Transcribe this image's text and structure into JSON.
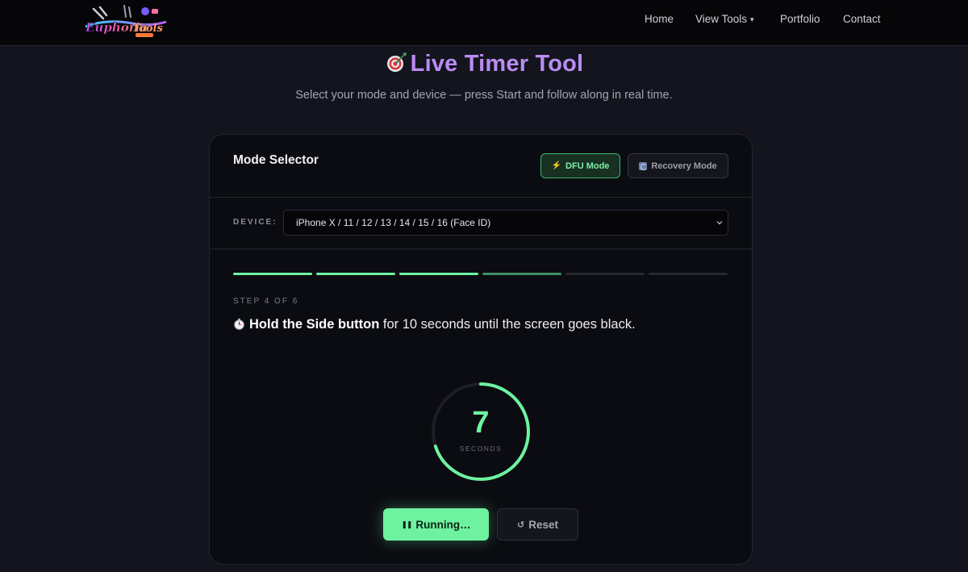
{
  "nav": {
    "home": "Home",
    "view_tools": "View Tools",
    "view_tools_caret": "▾",
    "portfolio": "Portfolio",
    "contact": "Contact"
  },
  "header": {
    "title": "Live Timer Tool",
    "subtitle": "Select your mode and device — press Start and follow along in real time."
  },
  "card": {
    "title": "Mode Selector",
    "modes": [
      {
        "label": "DFU Mode",
        "icon": "⚡",
        "selected": true
      },
      {
        "label": "Recovery Mode",
        "icon": "recovery-icon",
        "selected": false
      }
    ],
    "device_label": "DEVICE:",
    "device_value": "iPhone X / 11 / 12 / 13 / 14 / 15 / 16 (Face ID)",
    "progress": {
      "total_steps": 6,
      "completed_steps": 3,
      "current_step": 4
    },
    "step_label": "STEP 4 OF 6",
    "instruction": {
      "bold": "Hold the Side button",
      "rest": " for 10 seconds until the screen goes black."
    },
    "timer": {
      "value": "7",
      "unit": "SECONDS",
      "remaining_fraction": 0.7
    },
    "run_label": "Running…",
    "run_icon": "❚❚",
    "reset_label": "Reset",
    "reset_icon": "↺"
  },
  "colors": {
    "accent_green": "#6ef2a0",
    "title_purple": "#b98cf2",
    "background": "#13141d",
    "card": "#0b0c11"
  }
}
